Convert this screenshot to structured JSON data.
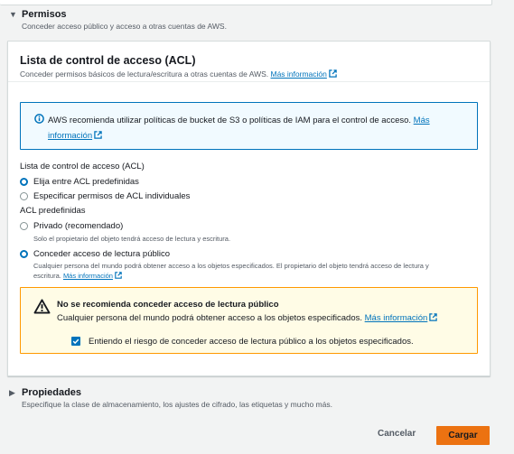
{
  "permissions": {
    "title": "Permisos",
    "description": "Conceder acceso público y acceso a otras cuentas de AWS."
  },
  "acl": {
    "title": "Lista de control de acceso (ACL)",
    "description": "Conceder permisos básicos de lectura/escritura a otras cuentas de AWS.",
    "more_info": "Más información",
    "info_box": {
      "text": "AWS recomienda utilizar políticas de bucket de S3 o políticas de IAM para el control de acceso.",
      "link_part1": "Más",
      "link_part2": "información"
    },
    "acl_field_label": "Lista de control de acceso (ACL)",
    "acl_options": [
      {
        "label": "Elija entre ACL predefinidas",
        "selected": true
      },
      {
        "label": "Especificar permisos de ACL individuales",
        "selected": false
      }
    ],
    "predefined_label": "ACL predefinidas",
    "predefined_options": [
      {
        "label": "Privado (recomendado)",
        "description": "Solo el propietario del objeto tendrá acceso de lectura y escritura.",
        "selected": false
      },
      {
        "label": "Conceder acceso de lectura público",
        "description_line1": "Cualquier persona del mundo podrá obtener acceso a los objetos especificados. El propietario del objeto tendrá acceso de lectura y",
        "description_line2": "escritura.",
        "link": "Más información",
        "selected": true
      }
    ],
    "warning": {
      "title": "No se recomienda conceder acceso de lectura público",
      "text": "Cualquier persona del mundo podrá obtener acceso a los objetos especificados.",
      "link": "Más información",
      "checkbox_label": "Entiendo el riesgo de conceder acceso de lectura público a los objetos especificados.",
      "checkbox_checked": true
    }
  },
  "properties": {
    "title": "Propiedades",
    "description": "Especifique la clase de almacenamiento, los ajustes de cifrado, las etiquetas y mucho más."
  },
  "footer": {
    "cancel_label": "Cancelar",
    "upload_label": "Cargar"
  },
  "colors": {
    "link": "#0073bb",
    "primary_button": "#ec7211",
    "warning_border": "#ff9900",
    "info_border": "#0073bb"
  }
}
